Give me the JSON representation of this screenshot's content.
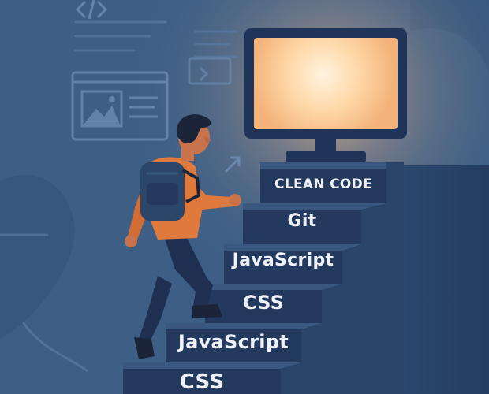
{
  "scene": {
    "steps": [
      {
        "label": "CLEAN CODE"
      },
      {
        "label": "Git"
      },
      {
        "label": "JavaScript"
      },
      {
        "label": "CSS"
      },
      {
        "label": "JavaScript"
      },
      {
        "label": "CSS"
      }
    ],
    "colors": {
      "background": "#3d5f86",
      "step_front": "#233a5e",
      "step_top": "#3a587f",
      "screen_glow": "#ffd8a8",
      "hoodie": "#e07a3c",
      "backpack": "#2b4668",
      "pants": "#1f2f52",
      "hair": "#1b2438"
    },
    "icons": [
      "monitor-icon",
      "code-brackets-icon",
      "browser-window-icon",
      "image-icon",
      "arrow-icon"
    ]
  }
}
